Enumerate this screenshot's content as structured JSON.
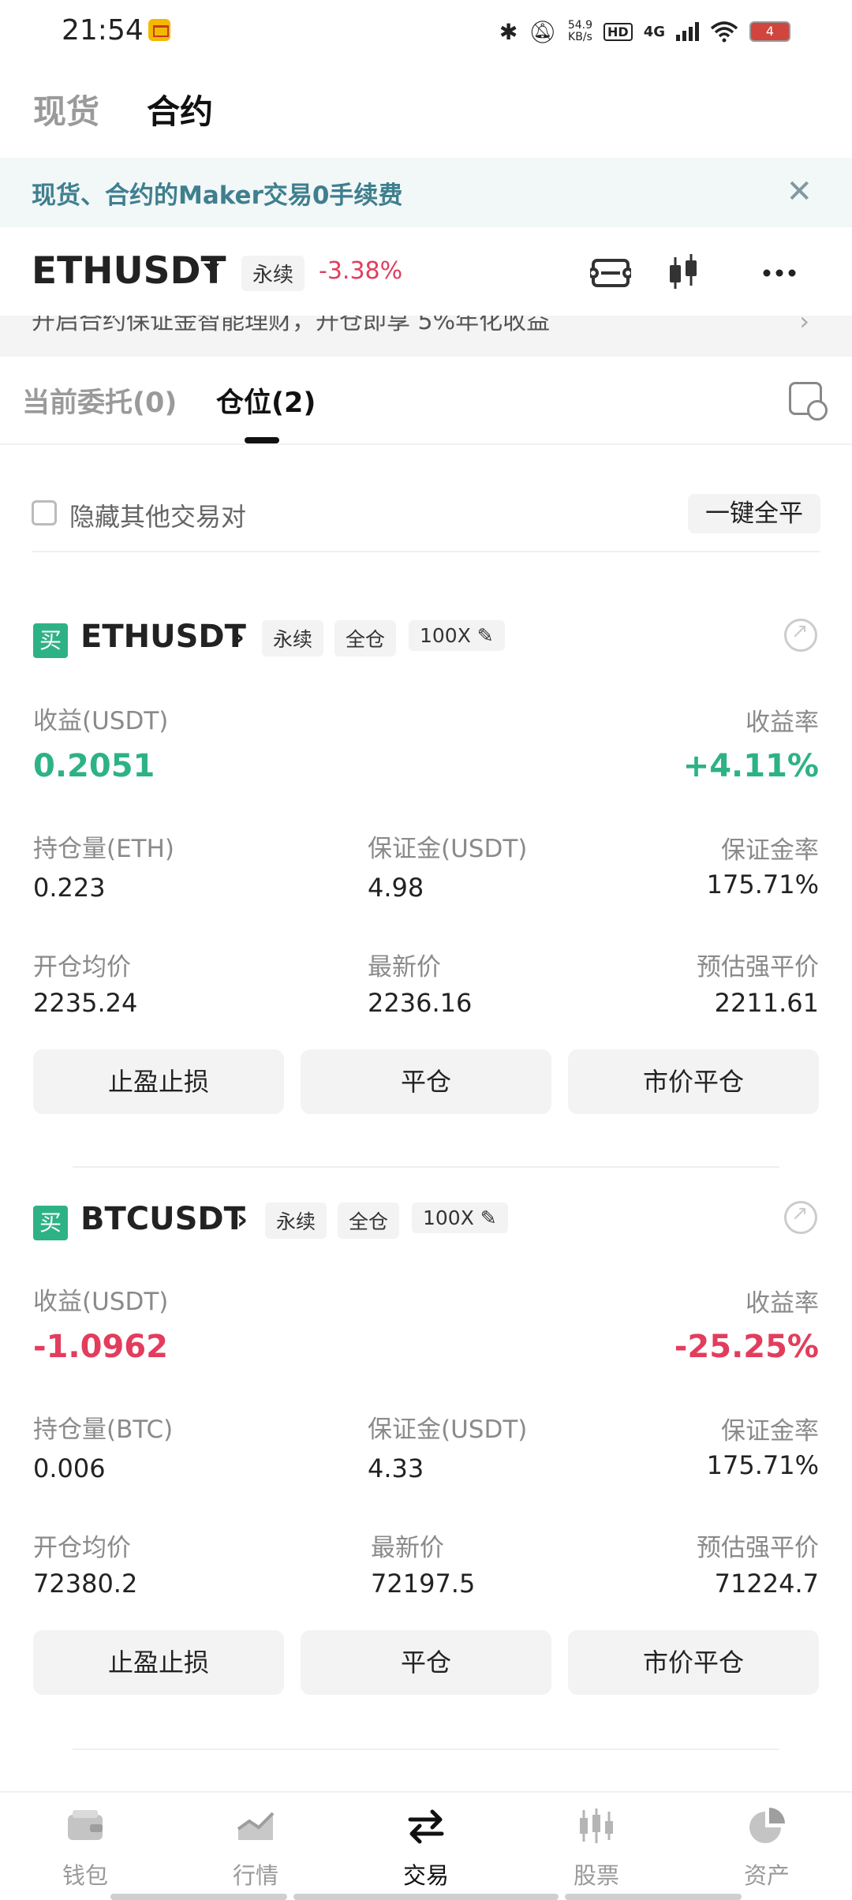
{
  "status_bar": {
    "time": "21:54",
    "speed_value": "54.9",
    "speed_unit": "KB/s",
    "hd_label": "HD",
    "signal_label": "4G",
    "battery": "4",
    "icons": [
      "message-icon",
      "bluetooth-icon",
      "mute-icon",
      "wifi-icon",
      "battery-icon"
    ]
  },
  "top_tabs": [
    {
      "label": "现货",
      "active": false
    },
    {
      "label": "合约",
      "active": true
    }
  ],
  "banner": {
    "text": "现货、合约的Maker交易0手续费",
    "close": "✕"
  },
  "pair_header": {
    "symbol": "ETHUSDT",
    "type_tag": "永续",
    "change": "-3.38%"
  },
  "promo": {
    "text": "开启合约保证金智能理财，开仓即享 5%年化收益",
    "arrow": "›"
  },
  "order_tabs": [
    {
      "label": "当前委托(0)",
      "active": false
    },
    {
      "label": "仓位(2)",
      "active": true
    }
  ],
  "filter": {
    "hide_others_label": "隐藏其他交易对",
    "close_all_label": "一键全平"
  },
  "labels": {
    "side_buy": "买",
    "pnl": "收益(USDT)",
    "pnl_rate": "收益率",
    "margin": "保证金(USDT)",
    "margin_rate": "保证金率",
    "entry_price": "开仓均价",
    "last_price": "最新价",
    "liq_price": "预估强平价",
    "tpsl_button": "止盈止损",
    "close_button": "平仓",
    "market_close_button": "市价平仓",
    "chevron": "›"
  },
  "positions": [
    {
      "symbol": "ETHUSDT",
      "type_tag": "永续",
      "margin_mode": "全仓",
      "leverage": "100X ✎",
      "pnl": "0.2051",
      "pnl_rate": "+4.11%",
      "size_label": "持仓量(ETH)",
      "size": "0.223",
      "margin": "4.98",
      "margin_rate": "175.71%",
      "entry_price": "2235.24",
      "last_price": "2236.16",
      "liq_price": "2211.61"
    },
    {
      "symbol": "BTCUSDT",
      "type_tag": "永续",
      "margin_mode": "全仓",
      "leverage": "100X ✎",
      "pnl": "-1.0962",
      "pnl_rate": "-25.25%",
      "size_label": "持仓量(BTC)",
      "size": "0.006",
      "margin": "4.33",
      "margin_rate": "175.71%",
      "entry_price": "72380.2",
      "last_price": "72197.5",
      "liq_price": "71224.7"
    }
  ],
  "colors": {
    "profit": "#2db286",
    "loss": "#e23d5d",
    "banner_text": "#3f7f8e"
  },
  "bottom_nav": [
    {
      "label": "钱包",
      "icon": "wallet-icon",
      "active": false
    },
    {
      "label": "行情",
      "icon": "chart-icon",
      "active": false
    },
    {
      "label": "交易",
      "icon": "trade-icon",
      "active": true
    },
    {
      "label": "股票",
      "icon": "stocks-icon",
      "active": false
    },
    {
      "label": "资产",
      "icon": "pie-chart-icon",
      "active": false
    }
  ]
}
